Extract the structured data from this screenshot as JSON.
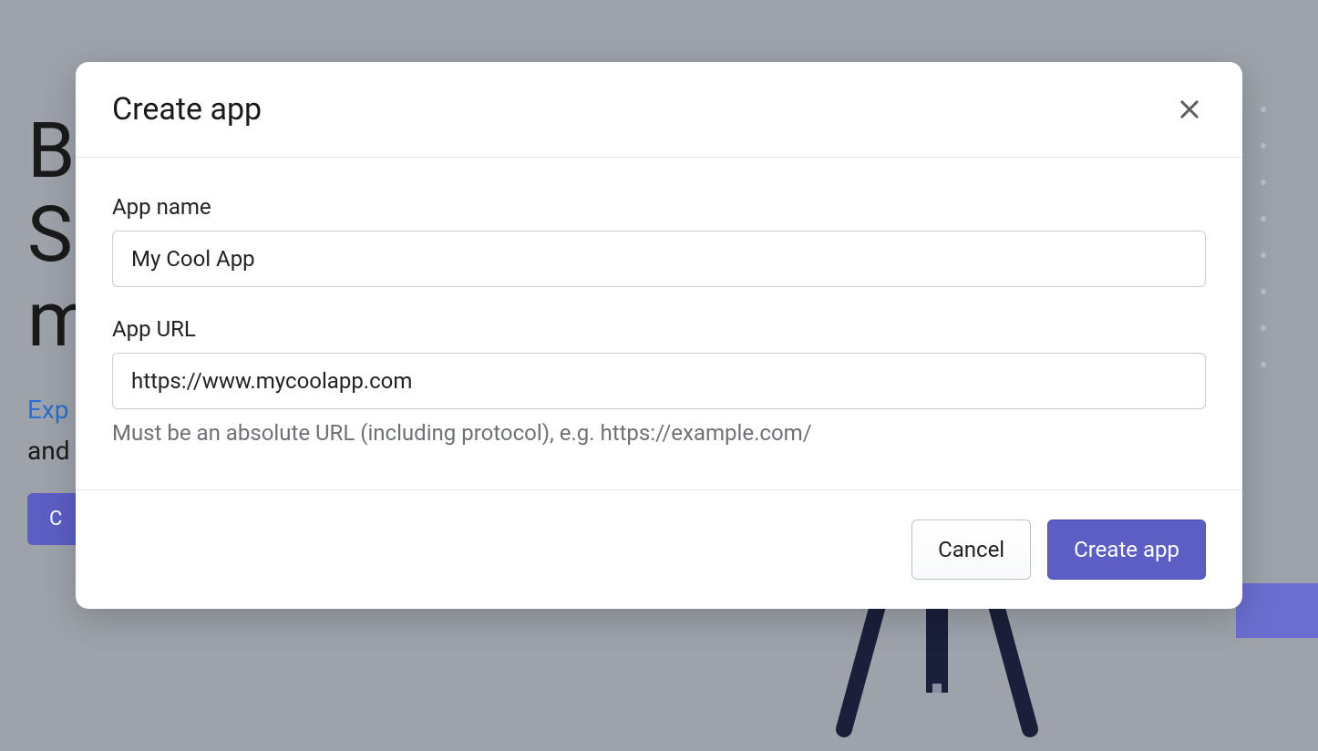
{
  "background": {
    "heading_line1": "B",
    "heading_line2": "S",
    "heading_line3": "m",
    "link_text": "Exp",
    "text_line": "and",
    "button_label": "C"
  },
  "modal": {
    "title": "Create app",
    "fields": {
      "app_name": {
        "label": "App name",
        "value": "My Cool App"
      },
      "app_url": {
        "label": "App URL",
        "value": "https://www.mycoolapp.com",
        "help": "Must be an absolute URL (including protocol), e.g. https://example.com/"
      }
    },
    "actions": {
      "cancel_label": "Cancel",
      "submit_label": "Create app"
    }
  }
}
